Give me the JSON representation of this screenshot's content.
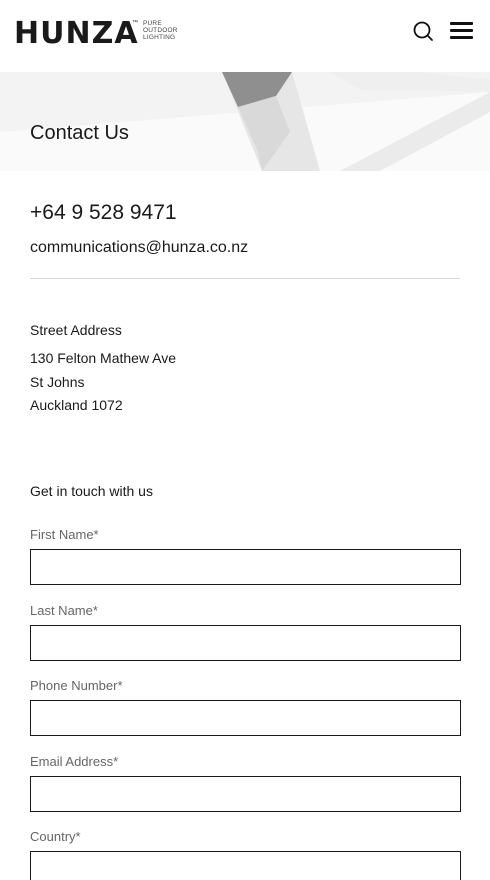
{
  "header": {
    "logo_text": "HUNZA",
    "logo_tm": "™",
    "logo_tagline": [
      "PURE",
      "OUTDOOR",
      "LIGHTING"
    ]
  },
  "banner": {
    "title": "Contact Us"
  },
  "contact": {
    "phone": "+64 9 528 9471",
    "email": "communications@hunza.co.nz"
  },
  "address": {
    "heading": "Street Address",
    "lines": [
      "130 Felton Mathew Ave",
      "St Johns",
      "Auckland 1072"
    ]
  },
  "form": {
    "heading": "Get in touch with us",
    "fields": [
      {
        "label": "First Name*",
        "value": ""
      },
      {
        "label": "Last Name*",
        "value": ""
      },
      {
        "label": "Phone Number*",
        "value": ""
      },
      {
        "label": "Email Address*",
        "value": ""
      },
      {
        "label": "Country*",
        "value": ""
      }
    ]
  },
  "colors": {
    "text": "#1a1a1a",
    "label": "#666666",
    "banner_bg": "#f4f4f4",
    "divider": "#d8d8d8"
  }
}
